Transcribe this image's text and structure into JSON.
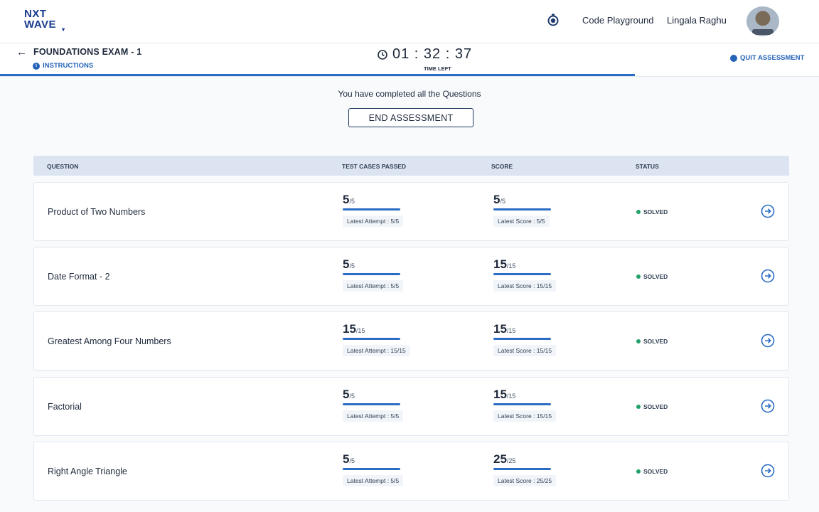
{
  "header": {
    "logo_line1": "NXT",
    "logo_line2": "WAVE",
    "code_playground": "Code Playground",
    "user_name": "Lingala Raghu"
  },
  "exam": {
    "title": "FOUNDATIONS EXAM - 1",
    "instructions": "INSTRUCTIONS",
    "timer": "01 : 32 : 37",
    "time_left": "TIME LEFT",
    "quit": "QUIT ASSESSMENT"
  },
  "summary": {
    "message": "You have completed all the Questions",
    "end_button": "END ASSESSMENT"
  },
  "table": {
    "headers": {
      "question": "QUESTION",
      "test_cases": "TEST CASES PASSED",
      "score": "SCORE",
      "status": "STATUS"
    },
    "rows": [
      {
        "question": "Product of Two Numbers",
        "tc_value": "5",
        "tc_max": "/5",
        "tc_latest": "Latest Attempt : 5/5",
        "score_value": "5",
        "score_max": "/5",
        "score_latest": "Latest Score : 5/5",
        "status": "SOLVED"
      },
      {
        "question": "Date Format - 2",
        "tc_value": "5",
        "tc_max": "/5",
        "tc_latest": "Latest Attempt : 5/5",
        "score_value": "15",
        "score_max": "/15",
        "score_latest": "Latest Score : 15/15",
        "status": "SOLVED"
      },
      {
        "question": "Greatest Among Four Numbers",
        "tc_value": "15",
        "tc_max": "/15",
        "tc_latest": "Latest Attempt : 15/15",
        "score_value": "15",
        "score_max": "/15",
        "score_latest": "Latest Score : 15/15",
        "status": "SOLVED"
      },
      {
        "question": "Factorial",
        "tc_value": "5",
        "tc_max": "/5",
        "tc_latest": "Latest Attempt : 5/5",
        "score_value": "15",
        "score_max": "/15",
        "score_latest": "Latest Score : 15/15",
        "status": "SOLVED"
      },
      {
        "question": "Right Angle Triangle",
        "tc_value": "5",
        "tc_max": "/5",
        "tc_latest": "Latest Attempt : 5/5",
        "score_value": "25",
        "score_max": "/25",
        "score_latest": "Latest Score : 25/25",
        "status": "SOLVED"
      }
    ]
  },
  "colors": {
    "brand": "#183b8c",
    "accent": "#2b6cc4",
    "solved": "#22a06b"
  }
}
